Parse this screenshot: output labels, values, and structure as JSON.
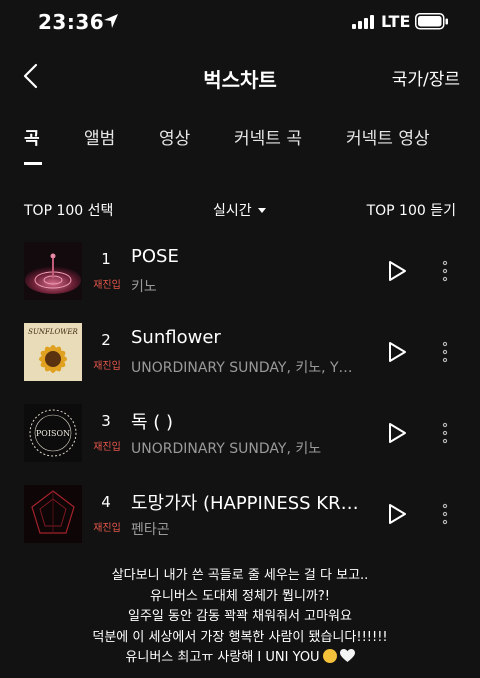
{
  "status_bar": {
    "time": "23:36",
    "network": "LTE"
  },
  "nav": {
    "title": "벅스차트",
    "right_label": "국가/장르"
  },
  "tabs": [
    {
      "label": "곡",
      "active": true
    },
    {
      "label": "앨범",
      "active": false
    },
    {
      "label": "영상",
      "active": false
    },
    {
      "label": "커넥트 곡",
      "active": false
    },
    {
      "label": "커넥트 영상",
      "active": false
    }
  ],
  "toolbar": {
    "select_label": "TOP 100 선택",
    "period": "실시간",
    "listen_label": "TOP 100 듣기"
  },
  "tracks": [
    {
      "rank": "1",
      "badge": "재진입",
      "title": "POSE",
      "artist": "키노"
    },
    {
      "rank": "2",
      "badge": "재진입",
      "title": "Sunflower",
      "artist": "UNORDINARY SUNDAY, 키노, Y…"
    },
    {
      "rank": "3",
      "badge": "재진입",
      "title": "독 ( )",
      "artist": "UNORDINARY SUNDAY, 키노"
    },
    {
      "rank": "4",
      "badge": "재진입",
      "title": "도망가자 (HAPPINESS KR…",
      "artist": "펜타곤"
    }
  ],
  "art_labels": {
    "sunflower": "SUNFLOWER",
    "poison": "POISON"
  },
  "caption_lines": [
    "살다보니 내가 쓴 곡들로 줄 세우는 걸 다 보고..",
    "유니버스 도대체 정체가 뭡니까?!",
    "일주일 동안 감동 꽉꽉 채워줘서 고마워요",
    "덕분에 이 세상에서 가장 행복한 사람이 됐습니다!!!!!!",
    "유니버스 최고ㅠ 사랑해 I UNI YOU"
  ],
  "colors": {
    "background": "#121212",
    "badge": "#e8574b",
    "secondary_text": "#9a9a9a"
  }
}
